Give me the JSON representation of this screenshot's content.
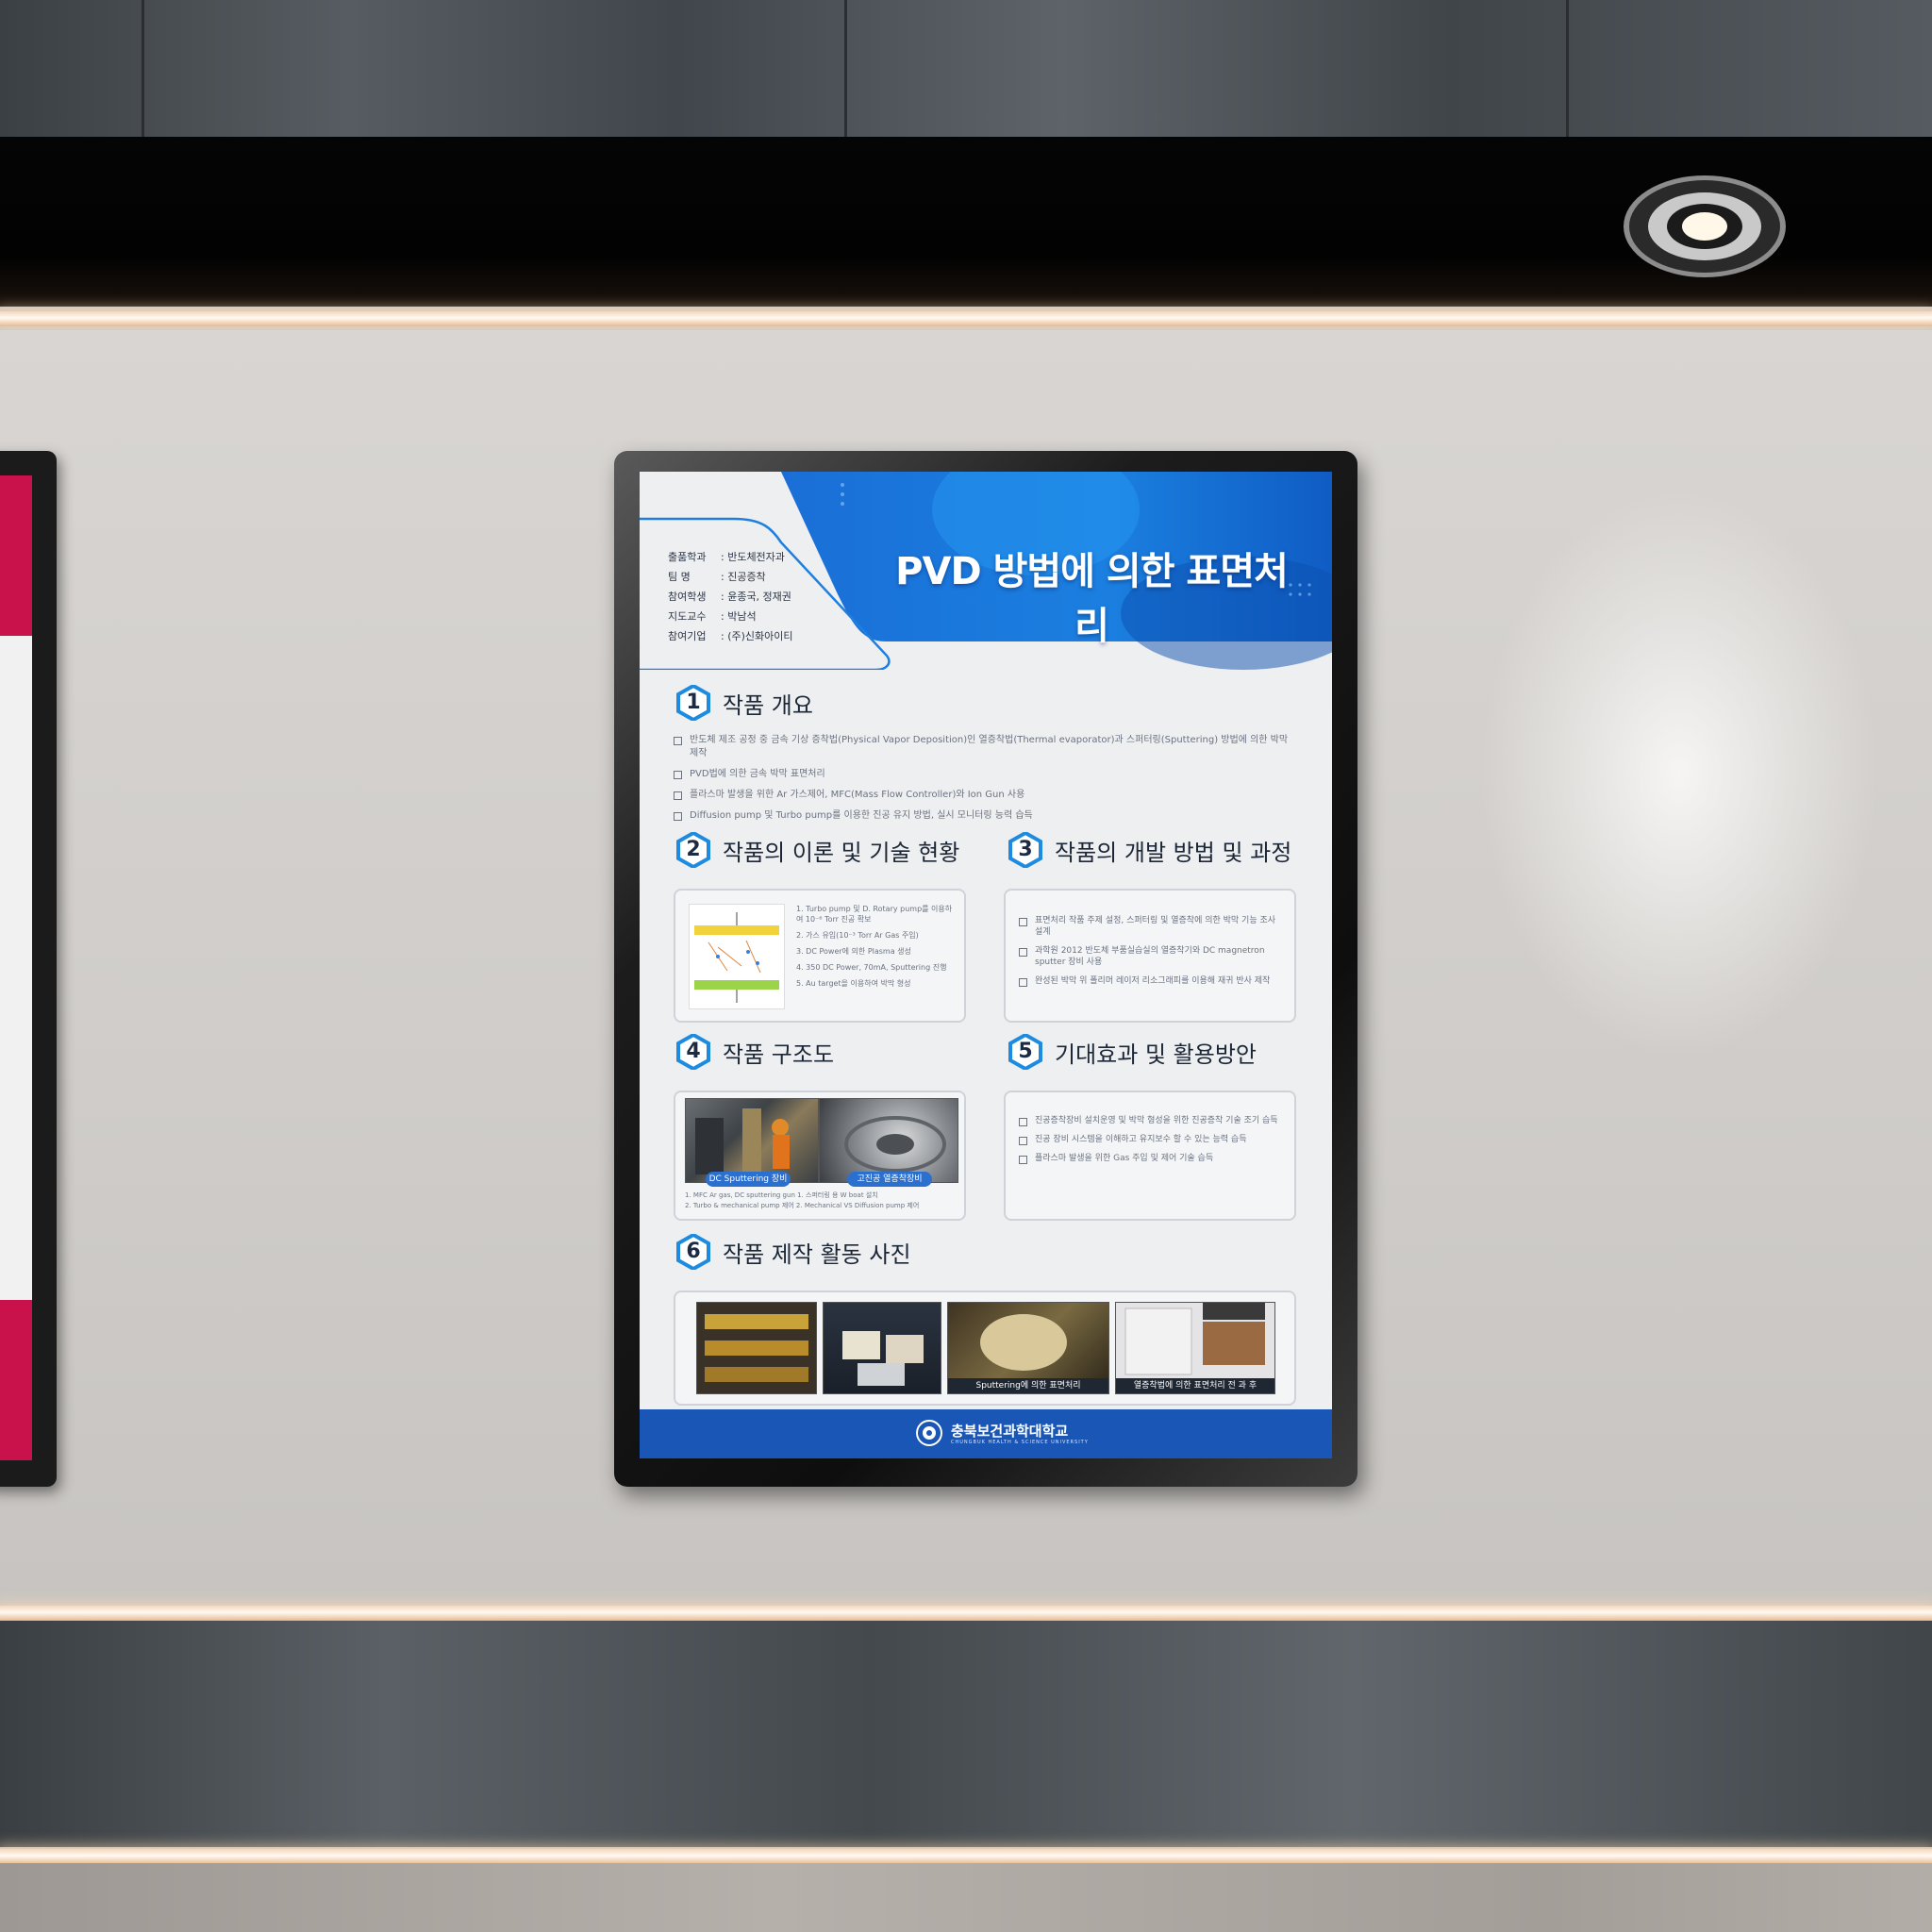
{
  "poster": {
    "title": "PVD 방법에 의한 표면처리",
    "info": [
      {
        "key": "출품학과",
        "value": ": 반도체전자과"
      },
      {
        "key": "팀      명",
        "value": ": 진공증착"
      },
      {
        "key": "참여학생",
        "value": ": 윤종국, 정재권"
      },
      {
        "key": "지도교수",
        "value": ": 박남석"
      },
      {
        "key": "참여기업",
        "value": ": (주)신화아이티"
      }
    ],
    "sections": [
      {
        "num": "1",
        "title": "작품 개요"
      },
      {
        "num": "2",
        "title": "작품의 이론 및 기술 현황"
      },
      {
        "num": "3",
        "title": "작품의 개발 방법 및 과정"
      },
      {
        "num": "4",
        "title": "작품 구조도"
      },
      {
        "num": "5",
        "title": "기대효과 및 활용방안"
      },
      {
        "num": "6",
        "title": "작품 제작 활동 사진"
      }
    ],
    "overview_bullets": [
      "반도체 제조 공정 중 금속 기상 증착법(Physical Vapor Deposition)인 열증착법(Thermal evaporator)과 스퍼터링(Sputtering) 방법에 의한 박막 제작",
      "PVD법에 의한 금속 박막 표면처리",
      "플라스마 발생을 위한 Ar 가스제어, MFC(Mass Flow Controller)와 Ion Gun 사용",
      "Diffusion pump 및 Turbo pump를 이용한 진공 유지 방법, 실시 모니터링 능력 습득"
    ],
    "theory_bullets": [
      "1. Turbo pump 및 D. Rotary pump를 이용하여 10⁻⁶ Torr 진공 확보",
      "2. 가스 유입(10⁻³ Torr Ar Gas 주입)",
      "3. DC Power에 의한 Plasma 생성",
      "4. 350 DC Power, 70mA, Sputtering 진행",
      "5. Au target을 이용하여 박막 형성"
    ],
    "method_bullets": [
      "표면처리 작품 주제 설정, 스퍼터링 및 열증착에 의한 박막 기능 조사 설계",
      "과학원 2012 반도체 부품실습실의 열증착기와 DC magnetron sputter 장비 사용",
      "완성된 박막 위 폴리머 레이저 리소그래피를 이용해 재귀 반사 제작"
    ],
    "effect_bullets": [
      "진공증착장비 설치운영 및 박막 형성을 위한 진공증착 기술 조기 습득",
      "진공 장비 시스템을 이해하고 유지보수 할 수 있는 능력 습득",
      "플라스마 발생을 위한 Gas 주입 및 제어 기술 습득"
    ],
    "structure": {
      "pill_left": "DC Sputtering 장비",
      "pill_right": "고진공 열증착장비",
      "captions": [
        "1. MFC Ar gas, DC sputtering gun   1. 스퍼터링 용 W boat 설치",
        "2. Turbo & mechanical pump 제어   2. Mechanical VS Diffusion pump 제어"
      ]
    },
    "photos": [
      {
        "caption": ""
      },
      {
        "caption": ""
      },
      {
        "caption": "Sputtering에 의한 표면처리"
      },
      {
        "caption": "열증착법에 의한 표면처리 전 과 후"
      }
    ],
    "footer": {
      "name": "충북보건과학대학교",
      "sub": "CHUNGBUK HEALTH & SCIENCE UNIVERSITY"
    }
  },
  "colors": {
    "brand_blue": "#1a56b6",
    "accent_blue": "#2b8fe0",
    "neighbor_red": "#c9124b"
  }
}
